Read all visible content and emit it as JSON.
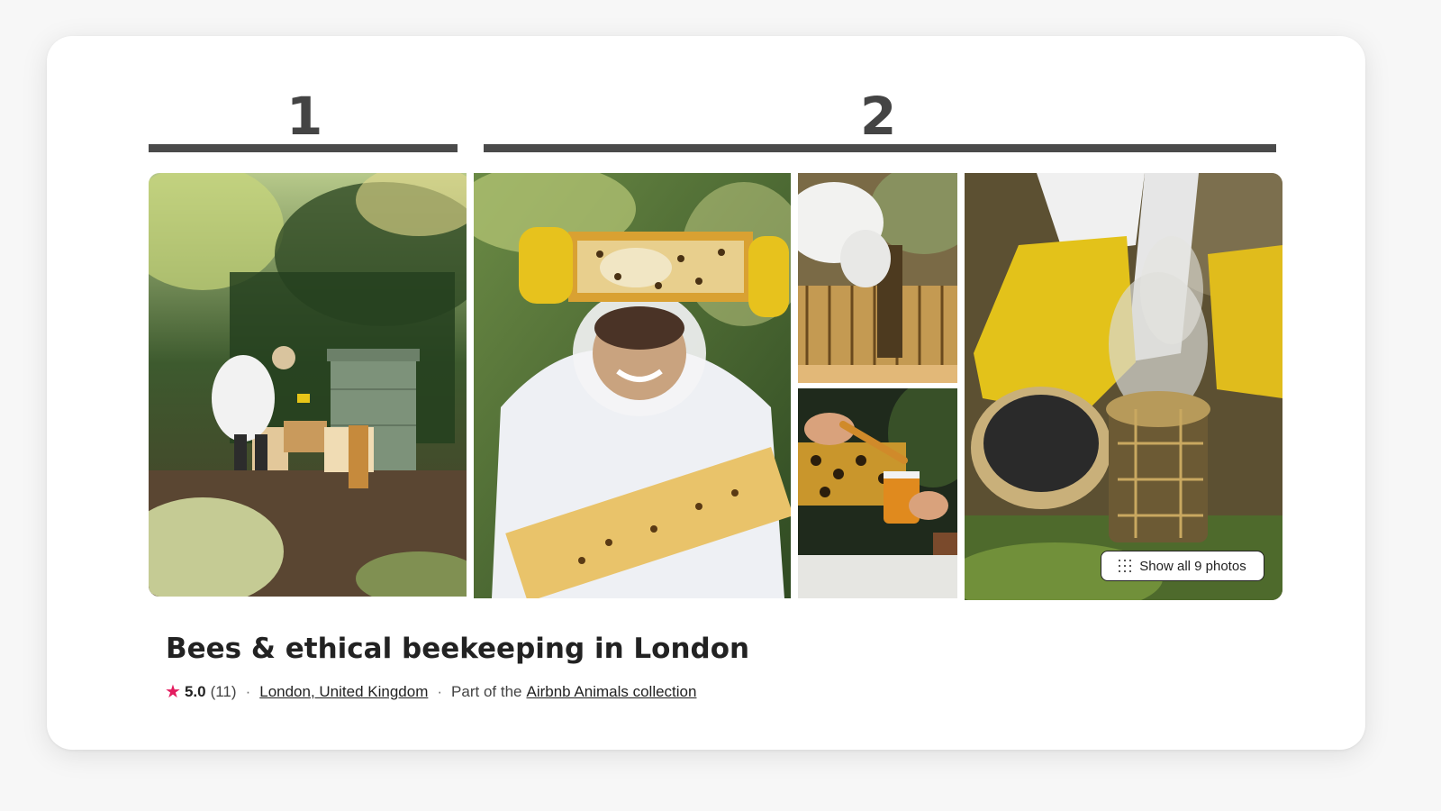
{
  "sections": {
    "first_label": "1",
    "second_label": "2"
  },
  "gallery": {
    "show_all_label": "Show all 9 photos",
    "photos": [
      {
        "name": "garden beekeeper with hives"
      },
      {
        "name": "smiling beekeeper holding honeycomb frame"
      },
      {
        "name": "gloved hands inspecting hive frames"
      },
      {
        "name": "honey spoon over jar"
      },
      {
        "name": "yellow gloves with bee smoker"
      }
    ]
  },
  "listing": {
    "title": "Bees & ethical beekeeping in London",
    "rating": "5.0",
    "reviews": "(11)",
    "separator": "·",
    "location": "London, United Kingdom",
    "collection_prefix": "Part of the",
    "collection_link": "Airbnb Animals collection"
  },
  "colors": {
    "star": "#e31c5f",
    "section_bar": "#4a4a4a",
    "text": "#222222"
  },
  "icons": {
    "rating": "star-icon",
    "show_all": "grid-dots-icon"
  }
}
